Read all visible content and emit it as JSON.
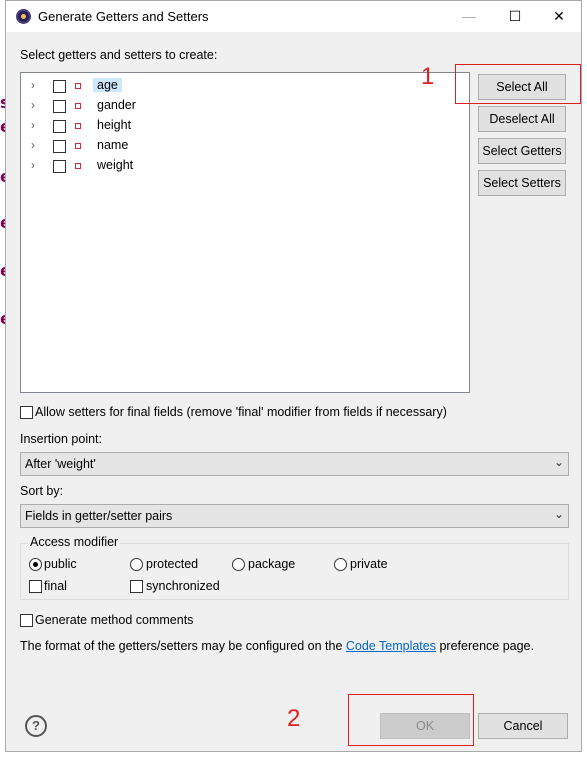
{
  "dialog": {
    "title": "Generate Getters and Setters",
    "instruction": "Select getters and setters to create:",
    "fields": [
      {
        "name": "age",
        "selected": true
      },
      {
        "name": "gander",
        "selected": false
      },
      {
        "name": "height",
        "selected": false
      },
      {
        "name": "name",
        "selected": false
      },
      {
        "name": "weight",
        "selected": false
      }
    ],
    "buttons": {
      "select_all": "Select All",
      "deselect_all": "Deselect All",
      "select_getters": "Select Getters",
      "select_setters": "Select Setters",
      "ok": "OK",
      "cancel": "Cancel"
    },
    "allow_setters_label": "Allow setters for final fields (remove 'final' modifier from fields if necessary)",
    "insertion_point": {
      "label": "Insertion point:",
      "value": "After 'weight'"
    },
    "sort_by": {
      "label": "Sort by:",
      "value": "Fields in getter/setter pairs"
    },
    "access_modifier": {
      "title": "Access modifier",
      "options": [
        "public",
        "protected",
        "package",
        "private"
      ],
      "selected": "public",
      "final_label": "final",
      "synchronized_label": "synchronized"
    },
    "generate_comments_label": "Generate method comments",
    "format_note": {
      "before": "The format of the getters/setters may be configured on the ",
      "link": "Code Templates",
      "after": " preference page."
    }
  },
  "annotations": {
    "first": "1",
    "second": "2"
  },
  "background": {
    "letters": [
      "s",
      "e",
      "e",
      "e",
      "e",
      "e"
    ]
  },
  "icons": {
    "title": "eclipse-icon",
    "help": "help-icon",
    "field": "field-icon"
  }
}
